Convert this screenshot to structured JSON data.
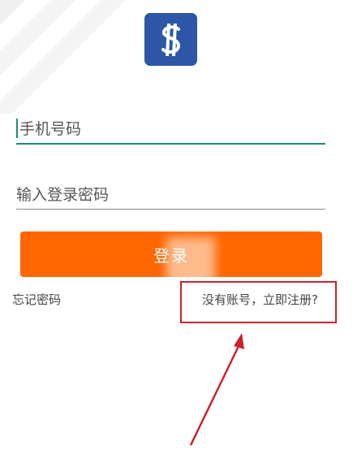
{
  "logo": {
    "symbol": "$",
    "background": "#2d56a6",
    "foreground": "#ffffff"
  },
  "form": {
    "phone_placeholder": "手机号码",
    "password_placeholder": "输入登录密码",
    "login_label": "登录",
    "forgot_label": "忘记密码",
    "register_label": "没有账号，立即注册?"
  },
  "colors": {
    "login_button": "#ff6600",
    "active_underline": "#1e8a73",
    "highlight": "#c8232b"
  },
  "annotation": {
    "icon": "red-arrow-icon"
  }
}
